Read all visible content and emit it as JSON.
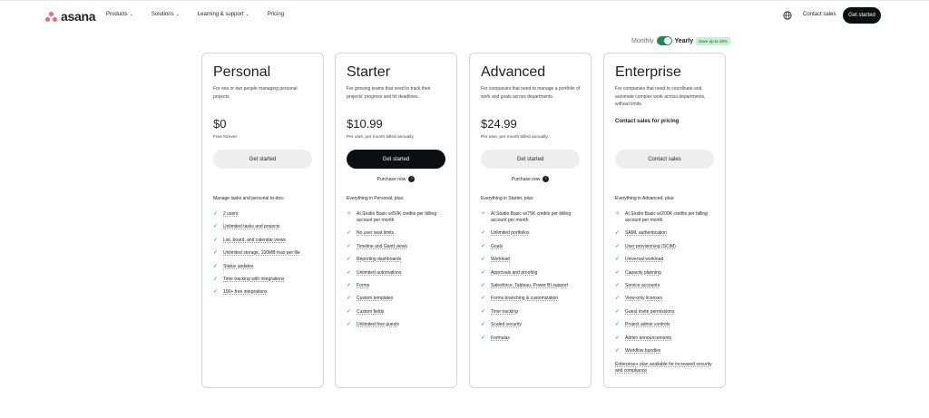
{
  "nav": {
    "logo": "asana",
    "items": [
      {
        "label": "Products",
        "chevron": true
      },
      {
        "label": "Solutions",
        "chevron": true
      },
      {
        "label": "Learning & support",
        "chevron": true
      },
      {
        "label": "Pricing",
        "chevron": false
      }
    ],
    "contact": "Contact sales",
    "get_started": "Get started"
  },
  "billing": {
    "monthly": "Monthly",
    "yearly": "Yearly",
    "badge": "Save up to 18%",
    "selected": "Yearly"
  },
  "plans": [
    {
      "name": "Personal",
      "desc": "For one or two people managing personal projects.",
      "price": "$0",
      "price_sub": "Free forever",
      "cta": "Get started",
      "features_head": "Manage tasks and personal to-dos:",
      "features": [
        {
          "text": "2 users"
        },
        {
          "text": "Unlimited tasks and projects"
        },
        {
          "text": "List, board, and calendar views"
        },
        {
          "text": "Unlimited storage, 100MB max per file"
        },
        {
          "text": "Status updates"
        },
        {
          "text": "Time tracking with integrations"
        },
        {
          "text": "100+ free integrations"
        }
      ]
    },
    {
      "name": "Starter",
      "desc": "For growing teams that need to track their projects' progress and hit deadlines.",
      "price": "$10.99",
      "price_sub": "Per user, per month billed annually",
      "cta": "Get started",
      "purchase": "Purchase now",
      "features_head": "Everything in Personal, plus:",
      "ai": "AI Studio Basic w/50K credits per billing account per month",
      "features": [
        {
          "text": "No user seat limits"
        },
        {
          "text": "Timeline and Gantt views"
        },
        {
          "text": "Reporting dashboards"
        },
        {
          "text": "Unlimited automations"
        },
        {
          "text": "Forms"
        },
        {
          "text": "Custom templates"
        },
        {
          "text": "Custom fields"
        },
        {
          "text": "Unlimited free guests"
        }
      ]
    },
    {
      "name": "Advanced",
      "desc": "For companies that need to manage a portfolio of work and goals across departments.",
      "price": "$24.99",
      "price_sub": "Per user, per month billed annually",
      "cta": "Get started",
      "purchase": "Purchase now",
      "features_head": "Everything in Starter, plus:",
      "ai": "AI Studio Basic w/75K credits per billing account per month",
      "features": [
        {
          "text": "Unlimited portfolios"
        },
        {
          "text": "Goals"
        },
        {
          "text": "Workload"
        },
        {
          "text": "Approvals and proofing"
        },
        {
          "text": "Salesforce, Tableau, Power BI support"
        },
        {
          "text": "Forms branching & customization"
        },
        {
          "text": "Time tracking"
        },
        {
          "text": "Scaled security"
        },
        {
          "text": "Formulas"
        }
      ]
    },
    {
      "name": "Enterprise",
      "desc": "For companies that need to coordinate and automate complex work across departments, without limits.",
      "contact_pricing": "Contact sales for pricing",
      "cta": "Contact sales",
      "features_head": "Everything in Advanced, plus:",
      "ai": "AI Studio Basic w/200K credits per billing account per month",
      "features": [
        {
          "text": "SAML authentication"
        },
        {
          "text": "User provisioning (SCIM)"
        },
        {
          "text": "Universal workload"
        },
        {
          "text": "Capacity planning"
        },
        {
          "text": "Service accounts"
        },
        {
          "text": "View-only licenses"
        },
        {
          "text": "Guest invite permissions"
        },
        {
          "text": "Project admin controls"
        },
        {
          "text": "Admin announcements"
        },
        {
          "text": "Workflow bundles"
        }
      ],
      "footnote": "Enterprise+ plan available for increased security and compliance"
    }
  ],
  "colors": {
    "accent_green": "#1f8a4c",
    "brand_coral": "#f06a6a",
    "dark_button": "#0d0e10"
  },
  "icons": {
    "feature_check": "check-icon",
    "ai_feature": "sparkle-icon",
    "purchase": "arrow-right-icon",
    "language": "globe-icon"
  }
}
